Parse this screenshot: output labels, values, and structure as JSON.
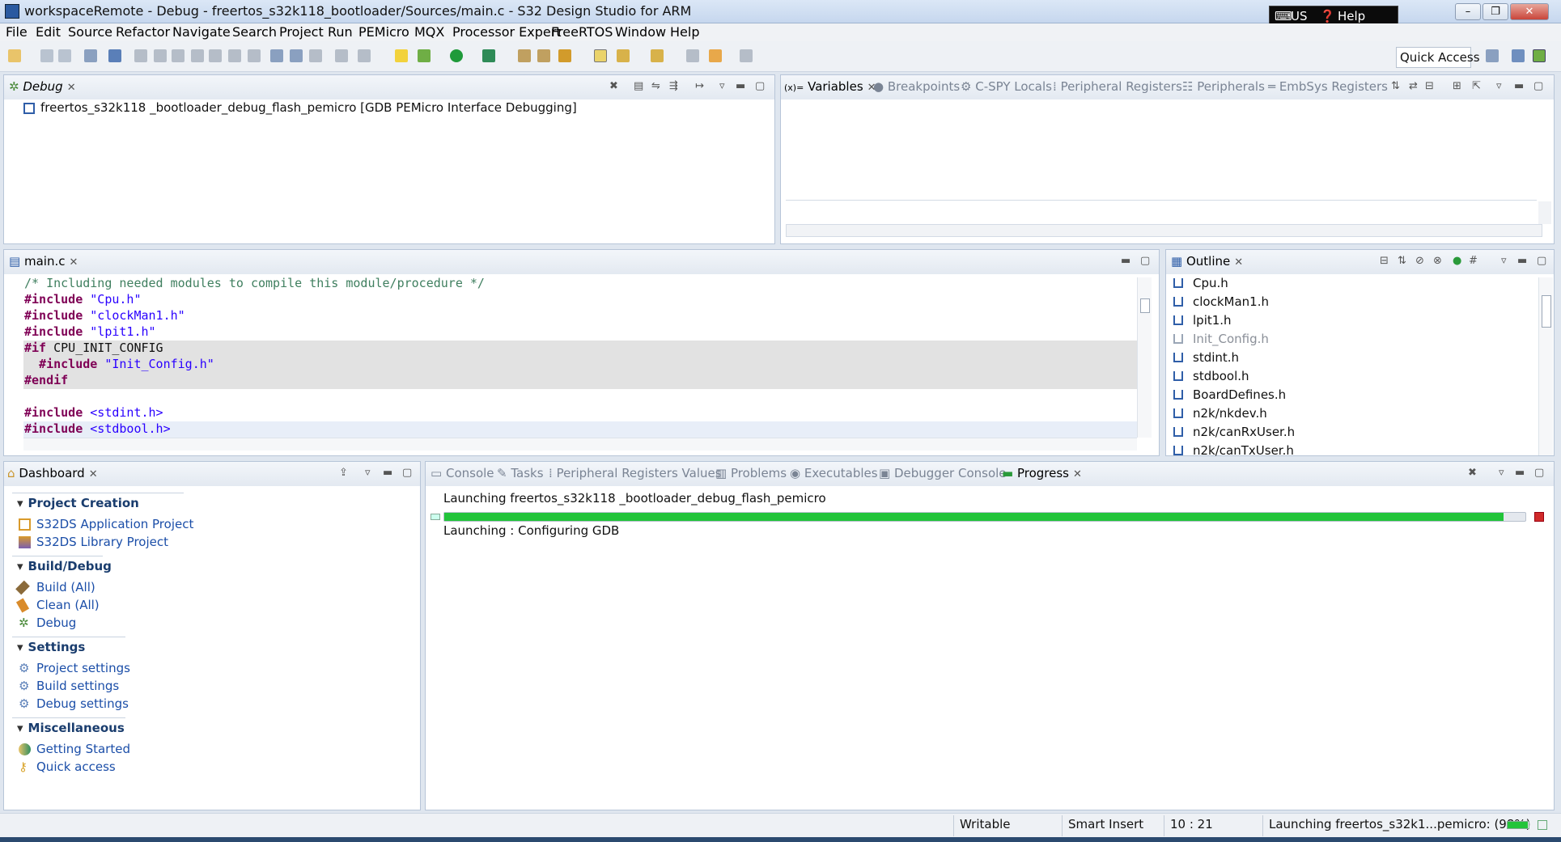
{
  "window": {
    "title": "workspaceRemote - Debug - freertos_s32k118_bootloader/Sources/main.c - S32 Design Studio for ARM",
    "lang": "US",
    "help": "Help",
    "min": "–",
    "max": "❐",
    "close": "✕"
  },
  "menu": [
    "File",
    "Edit",
    "Source",
    "Refactor",
    "Navigate",
    "Search",
    "Project",
    "Run",
    "PEMicro",
    "MQX",
    "Processor Expert",
    "FreeRTOS",
    "Window",
    "Help"
  ],
  "toolbar": {
    "quick_access": "Quick Access"
  },
  "debug_panel": {
    "tab": "Debug",
    "launch_item": "freertos_s32k118 _bootloader_debug_flash_pemicro [GDB PEMicro Interface Debugging]"
  },
  "variables_panel": {
    "tabs": [
      "Variables",
      "Breakpoints",
      "C-SPY Locals",
      "Peripheral Registers",
      "Peripherals",
      "EmbSys Registers"
    ]
  },
  "editor": {
    "tab": "main.c",
    "lines": [
      {
        "a": "/* Including needed modules to compile this module/procedure */",
        "b": ""
      },
      {
        "a": "#include",
        "b": " \"Cpu.h\""
      },
      {
        "a": "#include",
        "b": " \"clockMan1.h\""
      },
      {
        "a": "#include",
        "b": " \"lpit1.h\""
      },
      {
        "a": "#if",
        "b": " CPU_INIT_CONFIG"
      },
      {
        "a": "  #include",
        "b": " \"Init_Config.h\""
      },
      {
        "a": "#endif",
        "b": ""
      },
      {
        "a": "",
        "b": ""
      },
      {
        "a": "#include",
        "b": " <stdint.h>"
      },
      {
        "a": "#include",
        "b": " <stdbool.h>"
      }
    ]
  },
  "outline": {
    "tab": "Outline",
    "items": [
      "Cpu.h",
      "clockMan1.h",
      "lpit1.h",
      "Init_Config.h",
      "stdint.h",
      "stdbool.h",
      "BoardDefines.h",
      "n2k/nkdev.h",
      "n2k/canRxUser.h",
      "n2k/canTxUser.h"
    ]
  },
  "dashboard": {
    "tab": "Dashboard",
    "sections": [
      {
        "title": "Project Creation",
        "links": [
          "S32DS Application Project",
          "S32DS Library Project"
        ]
      },
      {
        "title": "Build/Debug",
        "links": [
          "Build  (All)",
          "Clean  (All)",
          "Debug"
        ]
      },
      {
        "title": "Settings",
        "links": [
          "Project settings",
          "Build settings",
          "Debug settings"
        ]
      },
      {
        "title": "Miscellaneous",
        "links": [
          "Getting Started",
          "Quick access"
        ]
      }
    ]
  },
  "console_panel": {
    "tabs": [
      "Console",
      "Tasks",
      "Peripheral Registers Values",
      "Problems",
      "Executables",
      "Debugger Console",
      "Progress"
    ],
    "progress_title": "Launching freertos_s32k118 _bootloader_debug_flash_pemicro",
    "progress_fraction": 0.98,
    "progress_status": "Launching : Configuring GDB"
  },
  "statusbar": {
    "writable": "Writable",
    "insert_mode": "Smart Insert",
    "position": "10 : 21",
    "progress_text": "Launching freertos_s32k1...pemicro: (98%)"
  },
  "colors": {
    "progress_fill": "#22c43a",
    "keyword": "#7f0055",
    "string": "#2a00ff",
    "comment": "#3f7f5f",
    "link": "#1b4ea8"
  }
}
